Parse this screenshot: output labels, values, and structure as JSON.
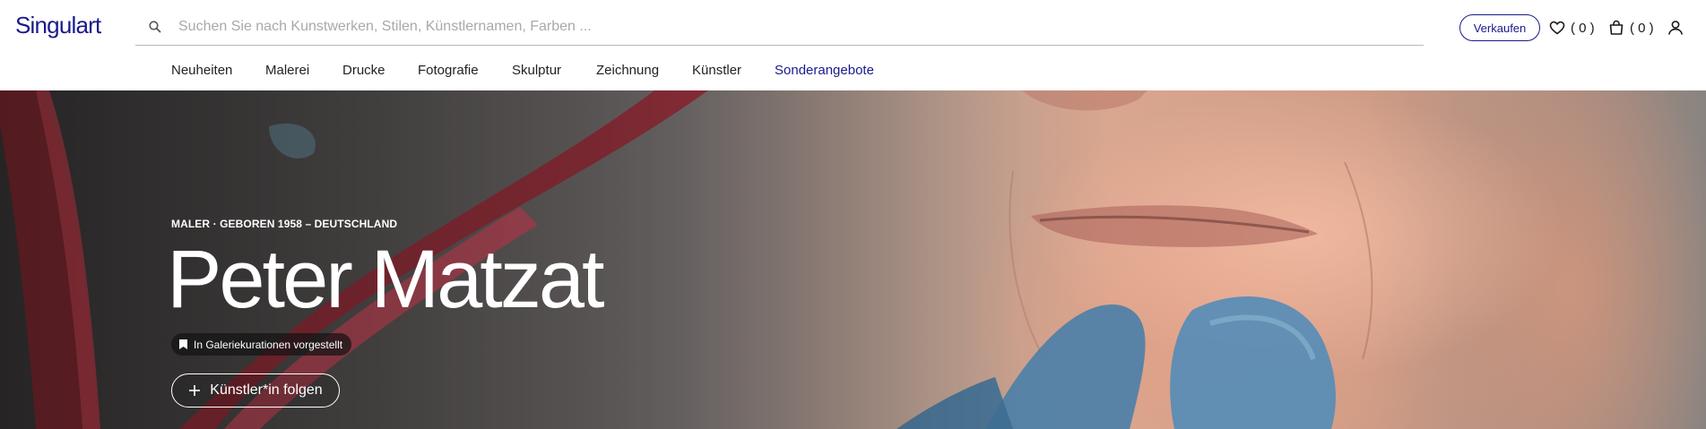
{
  "header": {
    "logo": "Singulart",
    "search_placeholder": "Suchen Sie nach Kunstwerken, Stilen, Künstlernamen, Farben ...",
    "search_icon": "search-icon",
    "sell_label": "Verkaufen",
    "wishlist_count": "( 0 )",
    "cart_count": "( 0 )",
    "wishlist_icon": "heart-icon",
    "cart_icon": "shopping-bag-icon",
    "account_icon": "user-icon"
  },
  "nav": {
    "items": [
      "Neuheiten",
      "Malerei",
      "Drucke",
      "Fotografie",
      "Skulptur",
      "Zeichnung",
      "Künstler",
      "Sonderangebote"
    ],
    "highlight_color": "#1a1a8c"
  },
  "hero": {
    "meta": "MALER · GEBOREN 1958 – DEUTSCHLAND",
    "name": "Peter Matzat",
    "badge": "In Galeriekurationen vorgestellt",
    "badge_icon": "bookmark-icon",
    "follow_label": "Künstler*in folgen",
    "follow_icon": "plus-icon"
  },
  "colors": {
    "brand": "#1a1a8c",
    "text": "#1a1a1a",
    "placeholder": "#a9a9a9"
  }
}
